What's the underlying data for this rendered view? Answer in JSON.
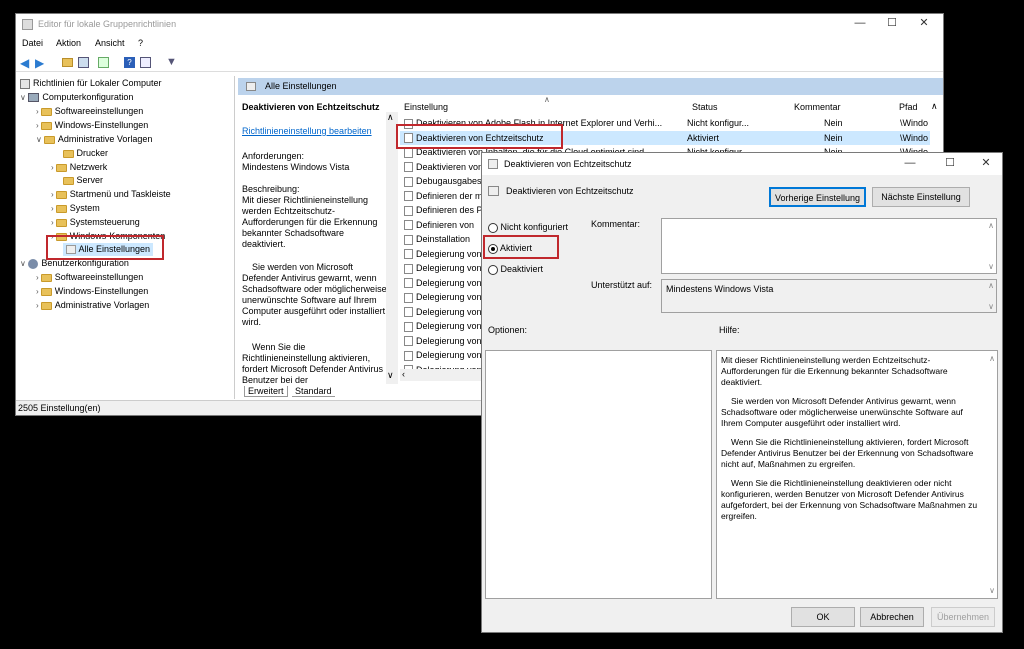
{
  "main_window": {
    "title": "Editor für lokale Gruppenrichtlinien",
    "menu": [
      "Datei",
      "Aktion",
      "Ansicht",
      "?"
    ],
    "statusbar": "2505 Einstellung(en)",
    "tree": {
      "root": "Richtlinien für Lokaler Computer",
      "items": [
        {
          "label": "Computerkonfiguration"
        },
        {
          "label": "Softwareeinstellungen"
        },
        {
          "label": "Windows-Einstellungen"
        },
        {
          "label": "Administrative Vorlagen"
        },
        {
          "label": "Drucker"
        },
        {
          "label": "Netzwerk"
        },
        {
          "label": "Server"
        },
        {
          "label": "Startmenü und Taskleiste"
        },
        {
          "label": "System"
        },
        {
          "label": "Systemsteuerung"
        },
        {
          "label": "Windows-Komponenten"
        },
        {
          "label": "Alle Einstellungen"
        },
        {
          "label": "Benutzerkonfiguration"
        },
        {
          "label": "Softwareeinstellungen"
        },
        {
          "label": "Windows-Einstellungen"
        },
        {
          "label": "Administrative Vorlagen"
        }
      ]
    },
    "content_header": "Alle Einstellungen",
    "description": {
      "title": "Deaktivieren von Echtzeitschutz",
      "edit_link": "Richtlinieneinstellung bearbeiten",
      "requirements_label": "Anforderungen:",
      "requirements_value": "Mindestens Windows Vista",
      "description_label": "Beschreibung:",
      "description_text": "Mit dieser Richtlinieneinstellung werden Echtzeitschutz-Aufforderungen für die Erkennung bekannter Schadsoftware deaktiviert.",
      "paragraph2": "Sie werden von Microsoft Defender Antivirus gewarnt, wenn Schadsoftware oder möglicherweise unerwünschte Software auf Ihrem Computer ausgeführt oder installiert wird.",
      "paragraph3": "Wenn Sie die Richtlinieneinstellung aktivieren, fordert Microsoft Defender Antivirus Benutzer bei der"
    },
    "columns": {
      "setting": "Einstellung",
      "status": "Status",
      "comment": "Kommentar",
      "path": "Pfad"
    },
    "rows": [
      {
        "setting": "Deaktivieren von Adobe Flash in Internet Explorer und Verhi...",
        "status": "Nicht konfigur...",
        "comment": "Nein",
        "path": "\\Windo"
      },
      {
        "setting": "Deaktivieren von Echtzeitschutz",
        "status": "Aktiviert",
        "comment": "Nein",
        "path": "\\Windo"
      },
      {
        "setting": "Deaktivieren von Inhalten, die für die Cloud optimiert sind",
        "status": "Nicht konfigur...",
        "comment": "Nein",
        "path": "\\Windo"
      },
      {
        "setting": "Deaktivieren von",
        "status": "",
        "comment": "",
        "path": ""
      },
      {
        "setting": "Debugausgabest",
        "status": "",
        "comment": "",
        "path": ""
      },
      {
        "setting": "Definieren der m",
        "status": "",
        "comment": "",
        "path": ""
      },
      {
        "setting": "Definieren des P",
        "status": "",
        "comment": "",
        "path": ""
      },
      {
        "setting": "Definieren von",
        "status": "",
        "comment": "",
        "path": ""
      },
      {
        "setting": "Deinstallation",
        "status": "",
        "comment": "",
        "path": ""
      },
      {
        "setting": "Delegierung von",
        "status": "",
        "comment": "",
        "path": ""
      },
      {
        "setting": "Delegierung von",
        "status": "",
        "comment": "",
        "path": ""
      },
      {
        "setting": "Delegierung von",
        "status": "",
        "comment": "",
        "path": ""
      },
      {
        "setting": "Delegierung von",
        "status": "",
        "comment": "",
        "path": ""
      },
      {
        "setting": "Delegierung von",
        "status": "",
        "comment": "",
        "path": ""
      },
      {
        "setting": "Delegierung von",
        "status": "",
        "comment": "",
        "path": ""
      },
      {
        "setting": "Delegierung von",
        "status": "",
        "comment": "",
        "path": ""
      },
      {
        "setting": "Delegierung von",
        "status": "",
        "comment": "",
        "path": ""
      },
      {
        "setting": "Delegierung von",
        "status": "",
        "comment": "",
        "path": ""
      }
    ],
    "tabs": [
      "Erweitert",
      "Standard"
    ]
  },
  "dialog": {
    "title": "Deaktivieren von Echtzeitschutz",
    "policy_name": "Deaktivieren von Echtzeitschutz",
    "prev_button": "Vorherige Einstellung",
    "next_button": "Nächste Einstellung",
    "options": [
      "Nicht konfiguriert",
      "Aktiviert",
      "Deaktiviert"
    ],
    "selected_option": "Aktiviert",
    "comment_label": "Kommentar:",
    "supported_label": "Unterstützt auf:",
    "supported_value": "Mindestens Windows Vista",
    "options_label": "Optionen:",
    "help_label": "Hilfe:",
    "help_paragraphs": [
      "Mit dieser Richtlinieneinstellung werden Echtzeitschutz-Aufforderungen für die Erkennung bekannter Schadsoftware deaktiviert.",
      "Sie werden von Microsoft Defender Antivirus gewarnt, wenn Schadsoftware oder möglicherweise unerwünschte Software auf Ihrem Computer ausgeführt oder installiert wird.",
      "Wenn Sie die Richtlinieneinstellung aktivieren, fordert Microsoft Defender Antivirus Benutzer bei der Erkennung von Schadsoftware nicht auf, Maßnahmen zu ergreifen.",
      "Wenn Sie die Richtlinieneinstellung deaktivieren oder nicht konfigurieren, werden Benutzer von Microsoft Defender Antivirus aufgefordert, bei der Erkennung von Schadsoftware Maßnahmen zu ergreifen."
    ],
    "ok_button": "OK",
    "cancel_button": "Abbrechen",
    "apply_button": "Übernehmen"
  },
  "colors": {
    "accent": "#0078d7",
    "highlight_red": "#c0282d",
    "header_blue": "#bcd3ec",
    "selected_row": "#cce8ff"
  }
}
